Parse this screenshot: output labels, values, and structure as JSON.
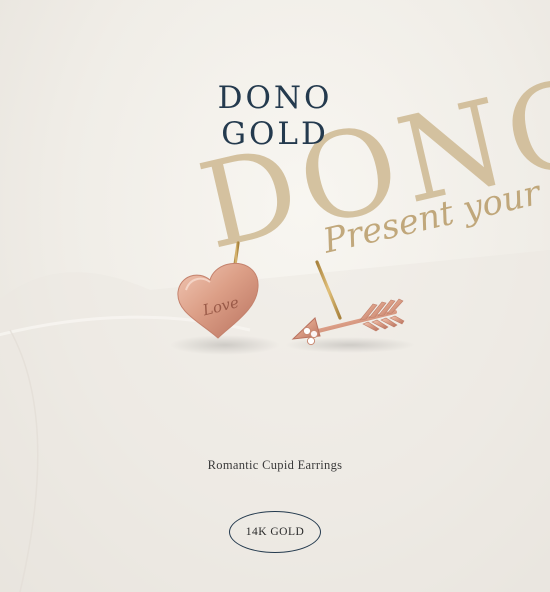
{
  "brand": {
    "line1": "DONO",
    "line2": "GOLD"
  },
  "background_print": {
    "word": "DONO",
    "slogan": "Present your story"
  },
  "product": {
    "engraving": "Love",
    "name": "Romantic Cupid Earrings",
    "badge": "14K GOLD"
  },
  "colors": {
    "navy": "#243a4e",
    "rose_gold": "#d89b84",
    "print_gold": "#c5ad7a",
    "paper": "#f3f0ea"
  }
}
